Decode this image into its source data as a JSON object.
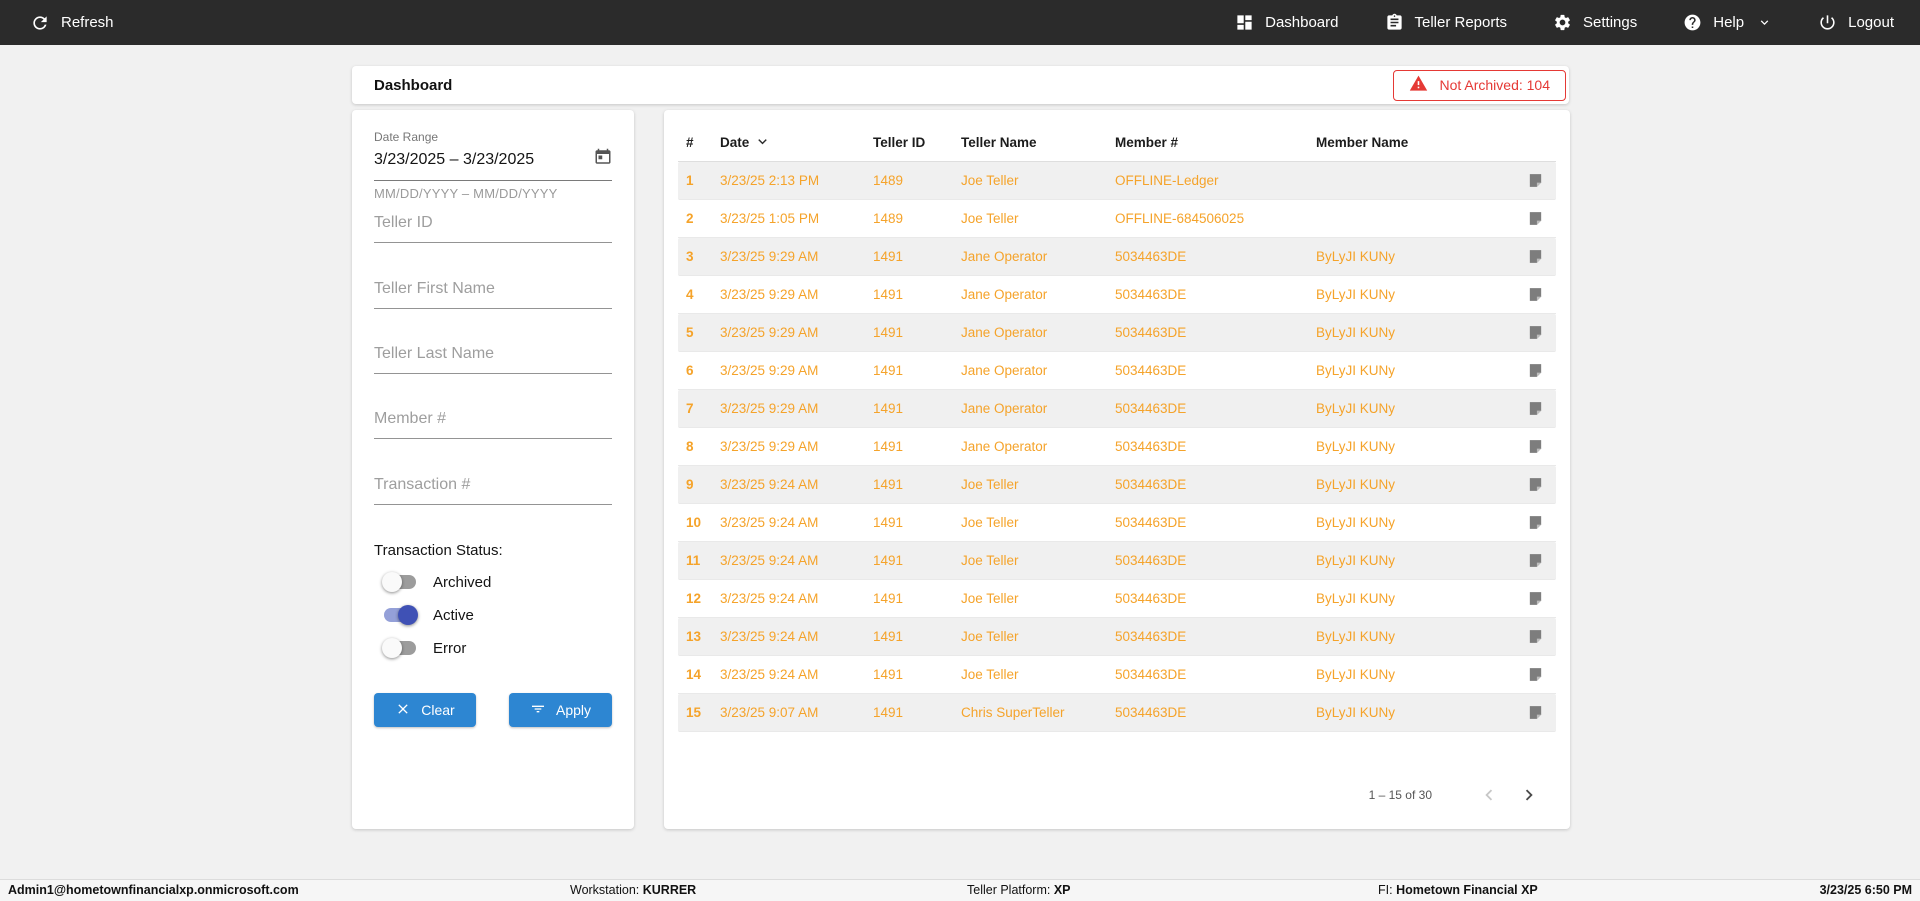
{
  "topbar": {
    "refresh_label": "Refresh",
    "nav": [
      {
        "label": "Dashboard",
        "icon": "dashboard-icon"
      },
      {
        "label": "Teller Reports",
        "icon": "reports-icon"
      },
      {
        "label": "Settings",
        "icon": "settings-icon"
      },
      {
        "label": "Help",
        "icon": "help-icon",
        "has_dropdown": true
      },
      {
        "label": "Logout",
        "icon": "logout-icon"
      }
    ]
  },
  "header": {
    "title": "Dashboard",
    "not_archived_badge": "Not Archived: 104"
  },
  "filters": {
    "date_range": {
      "label": "Date Range",
      "value": "3/23/2025 – 3/23/2025",
      "helper": "MM/DD/YYYY – MM/DD/YYYY"
    },
    "teller_id_placeholder": "Teller ID",
    "teller_first_name_placeholder": "Teller First Name",
    "teller_last_name_placeholder": "Teller Last Name",
    "member_number_placeholder": "Member #",
    "transaction_number_placeholder": "Transaction #",
    "status": {
      "label": "Transaction Status:",
      "toggles": [
        {
          "label": "Archived",
          "on": false
        },
        {
          "label": "Active",
          "on": true
        },
        {
          "label": "Error",
          "on": false
        }
      ]
    },
    "clear_button": "Clear",
    "apply_button": "Apply"
  },
  "table": {
    "columns": [
      "#",
      "Date",
      "Teller ID",
      "Teller Name",
      "Member #",
      "Member Name"
    ],
    "sorted_by": "Date",
    "sort_direction": "desc",
    "rows": [
      {
        "num": "1",
        "date": "3/23/25 2:13 PM",
        "teller_id": "1489",
        "teller_name": "Joe Teller",
        "member_number": "OFFLINE-Ledger",
        "member_name": ""
      },
      {
        "num": "2",
        "date": "3/23/25 1:05 PM",
        "teller_id": "1489",
        "teller_name": "Joe Teller",
        "member_number": "OFFLINE-684506025",
        "member_name": ""
      },
      {
        "num": "3",
        "date": "3/23/25 9:29 AM",
        "teller_id": "1491",
        "teller_name": "Jane Operator",
        "member_number": "5034463DE",
        "member_name": "ByLyJI KUNy"
      },
      {
        "num": "4",
        "date": "3/23/25 9:29 AM",
        "teller_id": "1491",
        "teller_name": "Jane Operator",
        "member_number": "5034463DE",
        "member_name": "ByLyJI KUNy"
      },
      {
        "num": "5",
        "date": "3/23/25 9:29 AM",
        "teller_id": "1491",
        "teller_name": "Jane Operator",
        "member_number": "5034463DE",
        "member_name": "ByLyJI KUNy"
      },
      {
        "num": "6",
        "date": "3/23/25 9:29 AM",
        "teller_id": "1491",
        "teller_name": "Jane Operator",
        "member_number": "5034463DE",
        "member_name": "ByLyJI KUNy"
      },
      {
        "num": "7",
        "date": "3/23/25 9:29 AM",
        "teller_id": "1491",
        "teller_name": "Jane Operator",
        "member_number": "5034463DE",
        "member_name": "ByLyJI KUNy"
      },
      {
        "num": "8",
        "date": "3/23/25 9:29 AM",
        "teller_id": "1491",
        "teller_name": "Jane Operator",
        "member_number": "5034463DE",
        "member_name": "ByLyJI KUNy"
      },
      {
        "num": "9",
        "date": "3/23/25 9:24 AM",
        "teller_id": "1491",
        "teller_name": "Joe Teller",
        "member_number": "5034463DE",
        "member_name": "ByLyJI KUNy"
      },
      {
        "num": "10",
        "date": "3/23/25 9:24 AM",
        "teller_id": "1491",
        "teller_name": "Joe Teller",
        "member_number": "5034463DE",
        "member_name": "ByLyJI KUNy"
      },
      {
        "num": "11",
        "date": "3/23/25 9:24 AM",
        "teller_id": "1491",
        "teller_name": "Joe Teller",
        "member_number": "5034463DE",
        "member_name": "ByLyJI KUNy"
      },
      {
        "num": "12",
        "date": "3/23/25 9:24 AM",
        "teller_id": "1491",
        "teller_name": "Joe Teller",
        "member_number": "5034463DE",
        "member_name": "ByLyJI KUNy"
      },
      {
        "num": "13",
        "date": "3/23/25 9:24 AM",
        "teller_id": "1491",
        "teller_name": "Joe Teller",
        "member_number": "5034463DE",
        "member_name": "ByLyJI KUNy"
      },
      {
        "num": "14",
        "date": "3/23/25 9:24 AM",
        "teller_id": "1491",
        "teller_name": "Joe Teller",
        "member_number": "5034463DE",
        "member_name": "ByLyJI KUNy"
      },
      {
        "num": "15",
        "date": "3/23/25 9:07 AM",
        "teller_id": "1491",
        "teller_name": "Chris SuperTeller",
        "member_number": "5034463DE",
        "member_name": "ByLyJI KUNy"
      }
    ],
    "pagination": {
      "range": "1 – 15 of 30",
      "prev_enabled": false,
      "next_enabled": true
    }
  },
  "statusbar": {
    "user": "Admin1@hometownfinancialxp.onmicrosoft.com",
    "workstation_label": "Workstation:",
    "workstation_value": "KURRER",
    "platform_label": "Teller Platform:",
    "platform_value": "XP",
    "fi_label": "FI:",
    "fi_value": "Hometown Financial XP",
    "datetime": "3/23/25 6:50 PM"
  },
  "colors": {
    "topbar_bg": "#2b2b2b",
    "accent_blue": "#2d86d2",
    "row_orange": "#f5a32a",
    "alert_red": "#e53935",
    "toggle_on": "#3f51b5",
    "row_stripe": "#f0f0f0"
  }
}
